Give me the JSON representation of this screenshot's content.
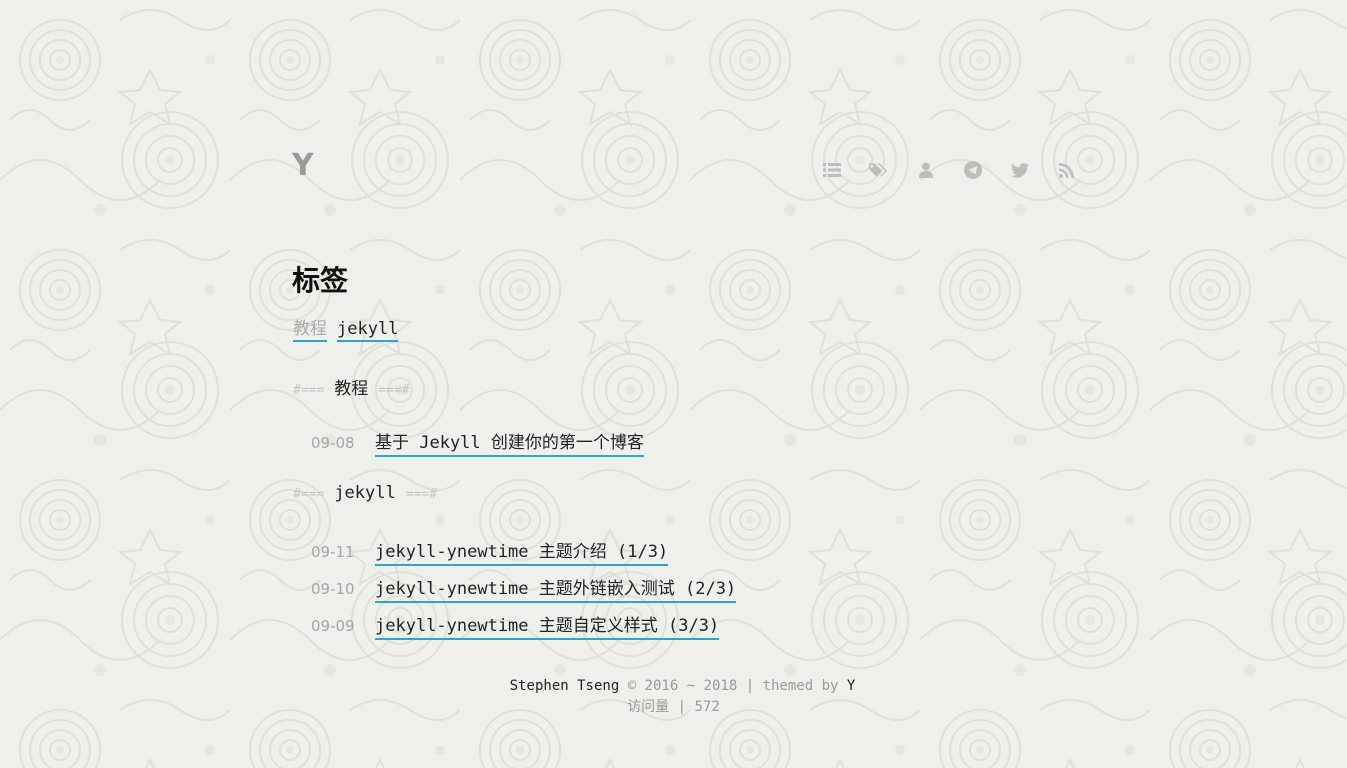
{
  "site": {
    "logo": "Y"
  },
  "nav": {
    "items": [
      {
        "icon": "list-icon"
      },
      {
        "icon": "tags-icon"
      },
      {
        "icon": "user-icon"
      },
      {
        "icon": "telegram-icon"
      },
      {
        "icon": "twitter-icon"
      },
      {
        "icon": "rss-icon"
      }
    ],
    "icon_color": "#bdbdbd"
  },
  "page": {
    "title": "标签"
  },
  "tags": [
    {
      "label": "教程",
      "state": "muted"
    },
    {
      "label": "jekyll",
      "state": "dark"
    }
  ],
  "sections": [
    {
      "deco_left": "#===",
      "name": "教程",
      "deco_right": "===#",
      "posts": [
        {
          "date": "09-08",
          "title": "基于 Jekyll 创建你的第一个博客"
        }
      ]
    },
    {
      "deco_left": "#===",
      "name": "jekyll",
      "deco_right": "===#",
      "posts": [
        {
          "date": "09-11",
          "title": "jekyll-ynewtime 主题介绍 (1/3)"
        },
        {
          "date": "09-10",
          "title": "jekyll-ynewtime 主题外链嵌入测试 (2/3)"
        },
        {
          "date": "09-09",
          "title": "jekyll-ynewtime 主题自定义样式 (3/3)"
        }
      ]
    }
  ],
  "footer": {
    "author": "Stephen Tseng",
    "copyright": "© 2016 ~ 2018",
    "sep1": "|",
    "themed_by": "themed by",
    "theme_link": "Y",
    "visits_label": "访问量",
    "sep2": "|",
    "visits_count": "572"
  },
  "colors": {
    "accent": "#2aa8c9",
    "background": "#efefeb",
    "muted_text": "#a5a5a5"
  }
}
